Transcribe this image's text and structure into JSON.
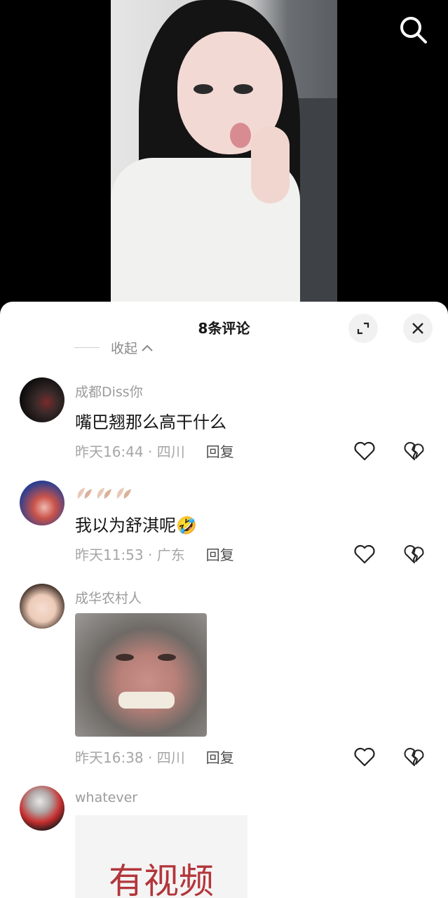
{
  "header": {
    "title": "8条评论",
    "collapse_label": "收起"
  },
  "comments": [
    {
      "nickname": "成都Diss你",
      "text": "嘴巴翘那么高干什么",
      "time_location": "昨天16:44 · 四川",
      "reply_label": "回复"
    },
    {
      "nickname_icons": "leaf-emoji x3",
      "text": "我以为舒淇呢🤣",
      "time_location": "昨天11:53 · 广东",
      "reply_label": "回复"
    },
    {
      "nickname": "成华农村人",
      "image": "monkey-laughing-sticker",
      "time_location": "昨天16:38 · 四川",
      "reply_label": "回复"
    },
    {
      "nickname": "whatever",
      "image_caption": "有视频"
    }
  ],
  "colors": {
    "accent_text": "#161616",
    "muted_text": "#9b9b9b",
    "sheet_bg": "#ffffff",
    "video_bg": "#000000"
  }
}
